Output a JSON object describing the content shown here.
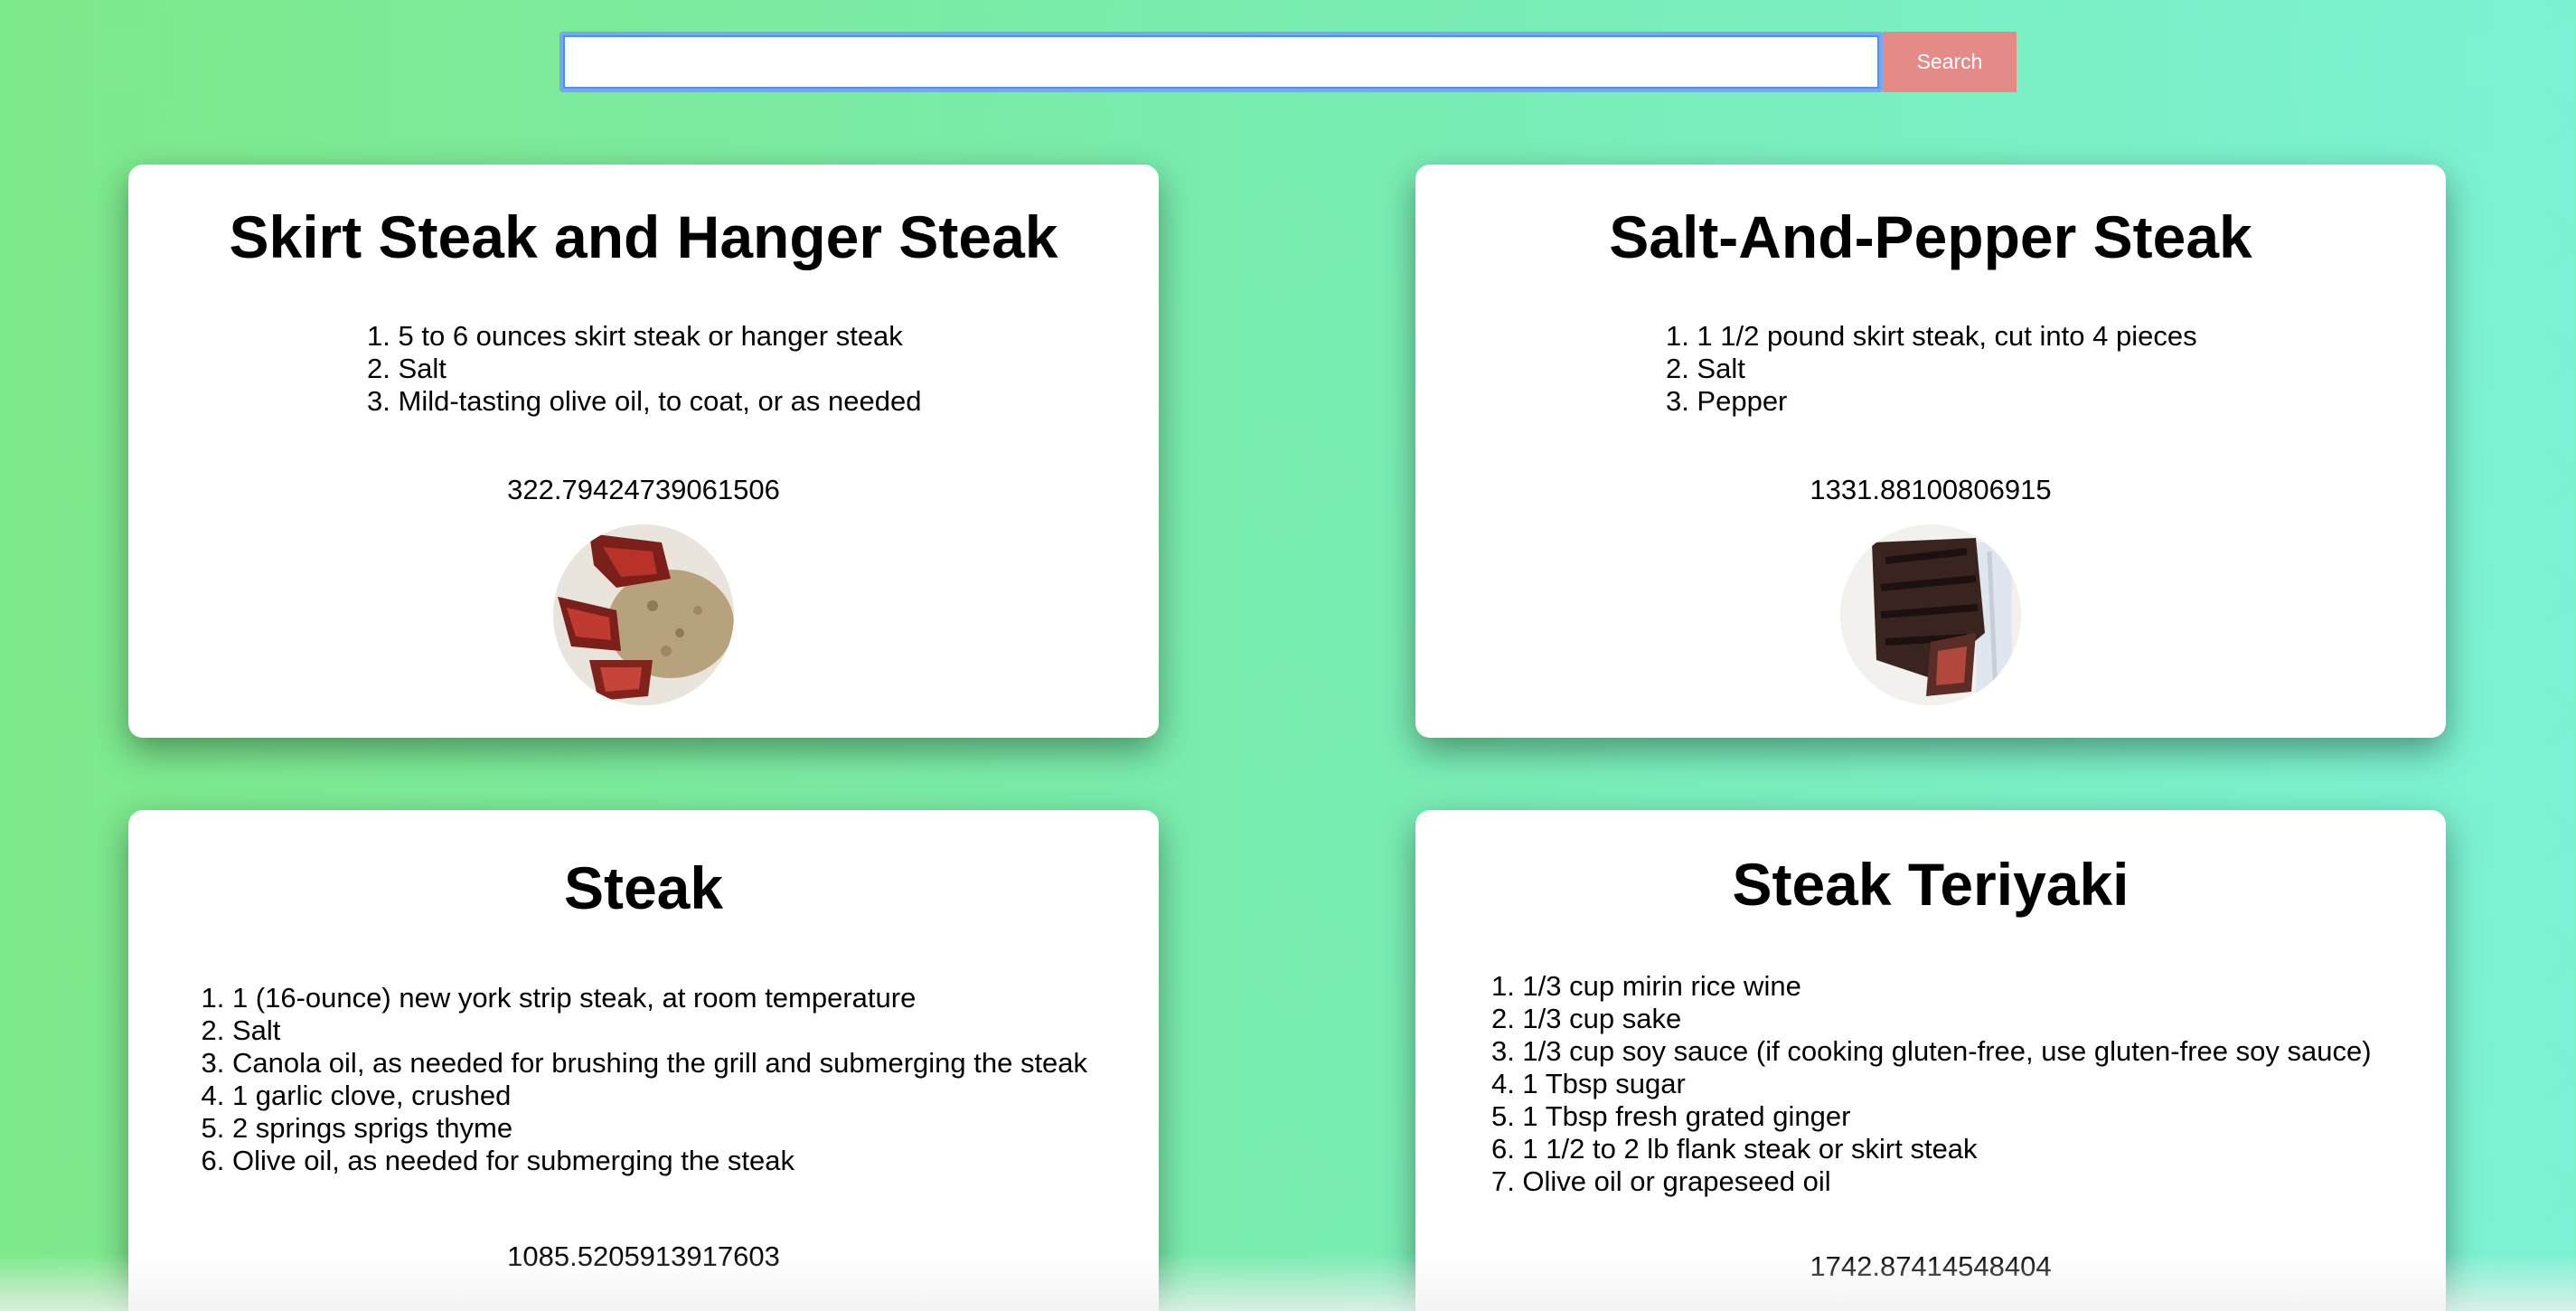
{
  "search": {
    "value": "",
    "button_label": "Search"
  },
  "recipes": [
    {
      "title": "Skirt Steak and Hanger Steak",
      "ingredients": [
        "5 to 6 ounces skirt steak or hanger steak",
        "Salt",
        "Mild-tasting olive oil, to coat, or as needed"
      ],
      "calories": "322.79424739061506"
    },
    {
      "title": "Salt-And-Pepper Steak",
      "ingredients": [
        "1 1/2 pound skirt steak, cut into 4 pieces",
        "Salt",
        "Pepper"
      ],
      "calories": "1331.88100806915"
    },
    {
      "title": "Steak",
      "ingredients": [
        "1 (16-ounce) new york strip steak, at room temperature",
        "Salt",
        "Canola oil, as needed for brushing the grill and submerging the steak",
        "1 garlic clove, crushed",
        "2 springs sprigs thyme",
        "Olive oil, as needed for submerging the steak"
      ],
      "calories": "1085.5205913917603"
    },
    {
      "title": "Steak Teriyaki",
      "ingredients": [
        "1/3 cup mirin rice wine",
        "1/3 cup sake",
        "1/3 cup soy sauce (if cooking gluten-free, use gluten-free soy sauce)",
        "1 Tbsp sugar",
        "1 Tbsp fresh grated ginger",
        "1 1/2 to 2 lb flank steak or skirt steak",
        "Olive oil or grapeseed oil"
      ],
      "calories": "1742.87414548404"
    }
  ]
}
